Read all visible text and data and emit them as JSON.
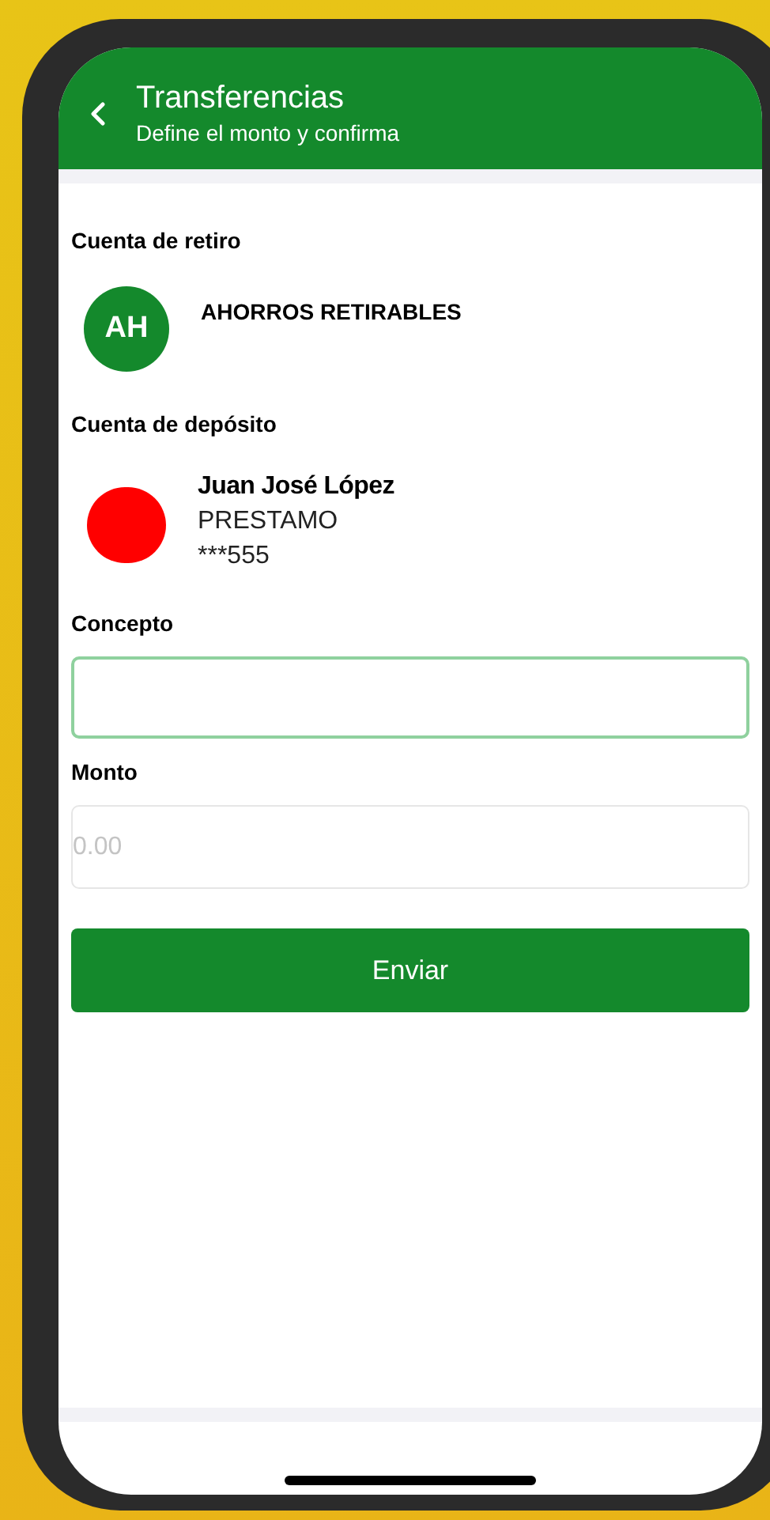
{
  "header": {
    "title": "Transferencias",
    "subtitle": "Define el monto y confirma"
  },
  "withdrawal": {
    "label": "Cuenta de retiro",
    "initials": "AH",
    "account_name": "AHORROS RETIRABLES"
  },
  "deposit": {
    "label": "Cuenta de depósito",
    "holder": "Juan José López",
    "account_type": "PRESTAMO",
    "account_number": "***555"
  },
  "concept": {
    "label": "Concepto"
  },
  "amount": {
    "label": "Monto",
    "placeholder": "0.00"
  },
  "submit_button": "Enviar"
}
